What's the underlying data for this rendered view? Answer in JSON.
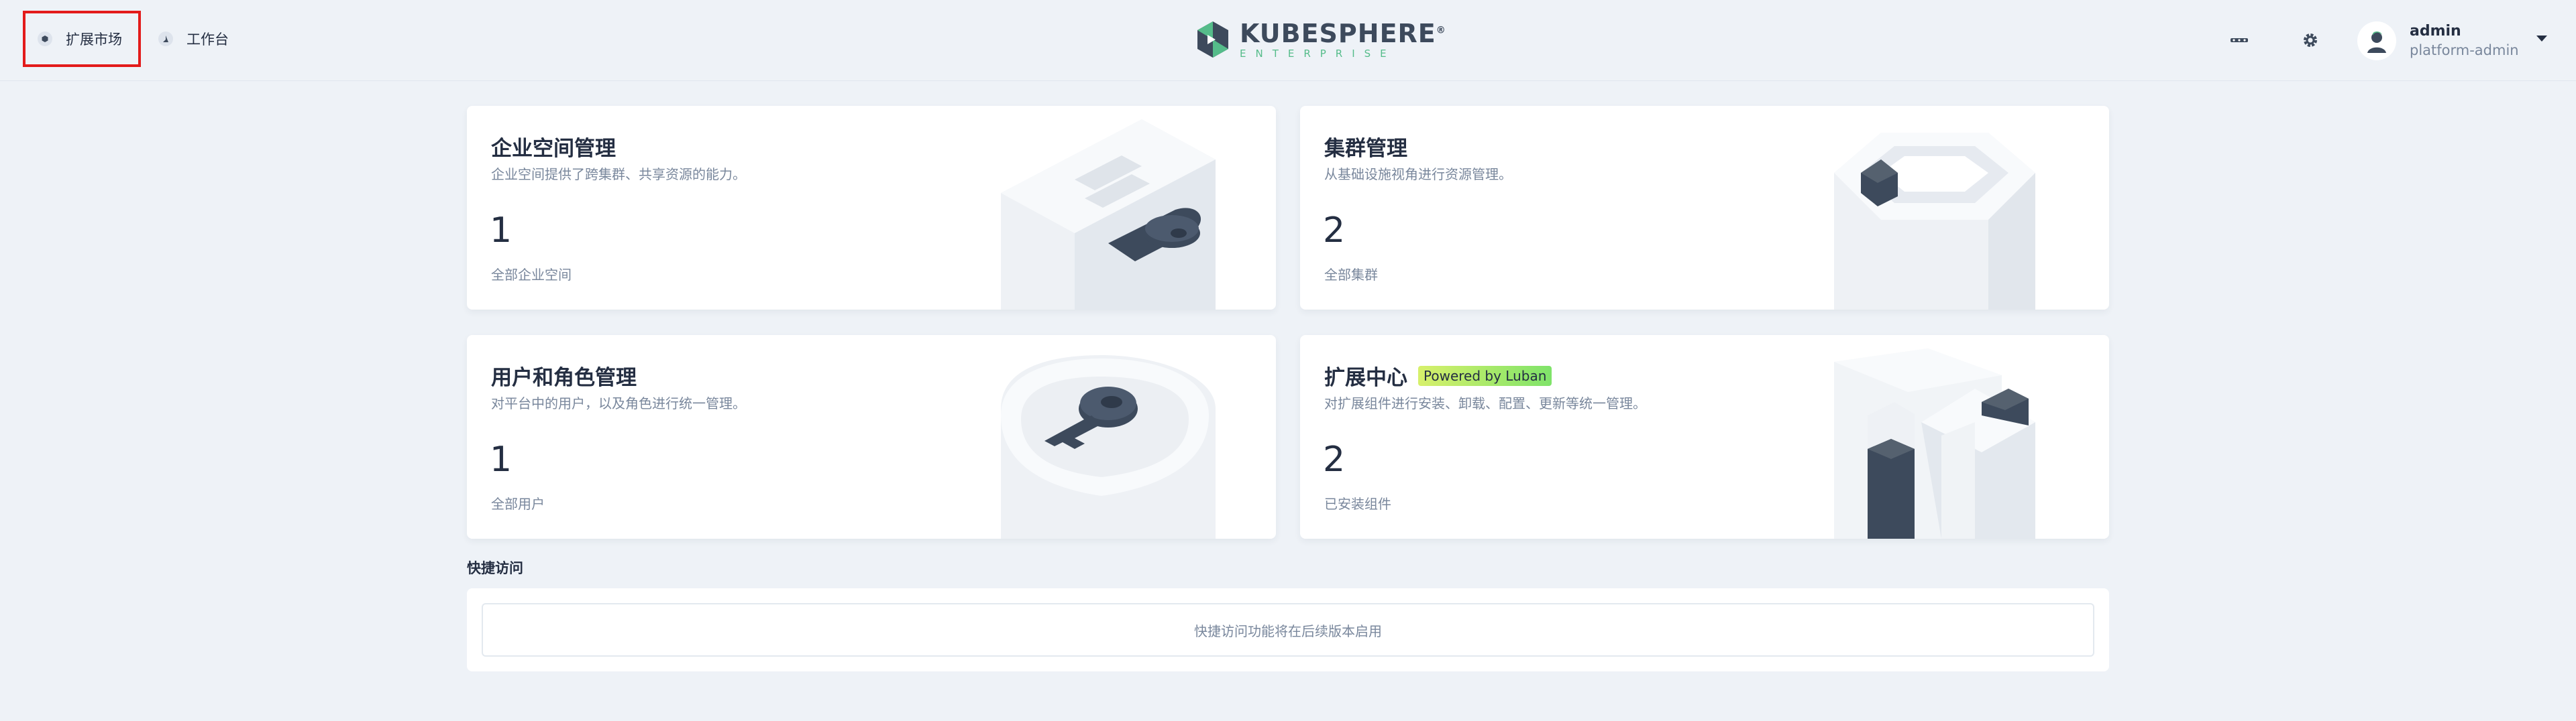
{
  "header": {
    "nav": [
      {
        "label": "扩展市场",
        "icon": "extension-market-icon"
      },
      {
        "label": "工作台",
        "icon": "workbench-icon"
      }
    ],
    "logo": {
      "main": "KUBESPHERE",
      "registered": "®",
      "sub": "ENTERPRISE"
    },
    "user": {
      "name": "admin",
      "role": "platform-admin"
    }
  },
  "cards": [
    {
      "title": "企业空间管理",
      "desc": "企业空间提供了跨集群、共享资源的能力。",
      "count": "1",
      "label": "全部企业空间"
    },
    {
      "title": "集群管理",
      "desc": "从基础设施视角进行资源管理。",
      "count": "2",
      "label": "全部集群"
    },
    {
      "title": "用户和角色管理",
      "desc": "对平台中的用户，以及角色进行统一管理。",
      "count": "1",
      "label": "全部用户"
    },
    {
      "title": "扩展中心",
      "badge": "Powered by Luban",
      "desc": "对扩展组件进行安装、卸载、配置、更新等统一管理。",
      "count": "2",
      "label": "已安装组件"
    }
  ],
  "quick_access": {
    "title": "快捷访问",
    "empty_text": "快捷访问功能将在后续版本启用"
  },
  "colors": {
    "accent": "#55bc8a",
    "dark": "#3d4a5c",
    "text": "#242e42",
    "muted": "#79879c",
    "highlight": "#e31b1b"
  }
}
